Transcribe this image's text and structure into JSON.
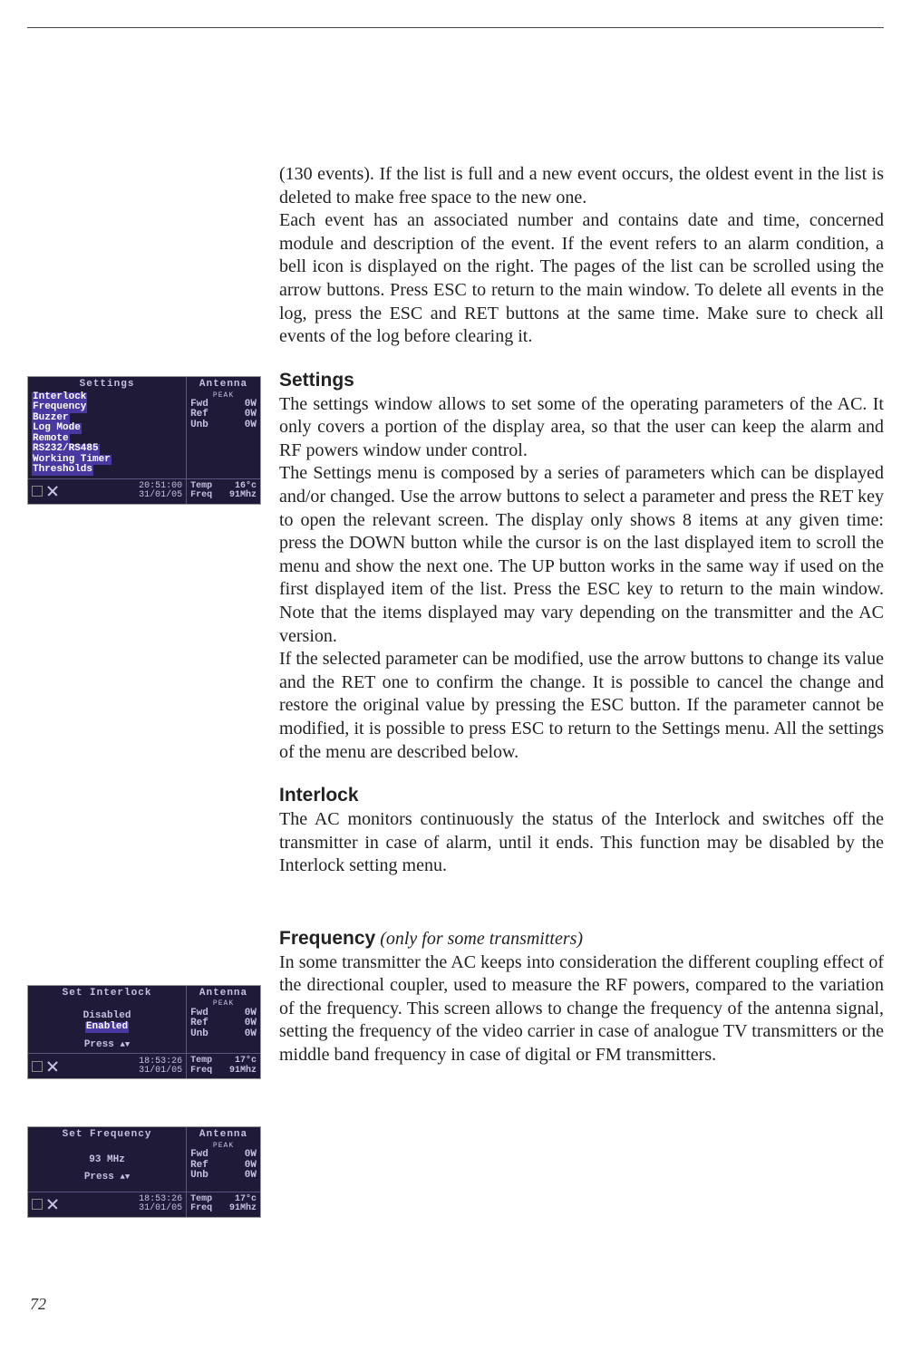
{
  "intro": {
    "p1": "(130 events). If the list is full and a new event occurs, the oldest event in the list is deleted to make free space to the new one.",
    "p2": "Each event has an associated number and contains date and time, concerned module and description of the event. If the event refers to an alarm condition, a bell icon is displayed on the right. The pages of the list can be scrolled using the arrow buttons. Press ESC to return to the main window. To delete all events in the log, press the ESC and RET buttons at the same time. Make sure to check all events of the log before clearing it."
  },
  "settings": {
    "heading": "Settings",
    "p1": "The settings window allows to set some of the operating parameters of the AC. It only covers a portion of the display area, so that the user can keep the alarm and RF powers window under control.",
    "p2": "The Settings menu is composed by a series of parameters which can be displayed and/or changed. Use the arrow buttons to select a parameter and press the RET key to open the relevant screen. The display only shows 8 items at any given time: press the DOWN button while the cursor is on the last displayed item to scroll the menu and show the next one. The UP button works in the same way if used on the first displayed item of the list. Press the ESC key to return to the main window. Note that the items displayed may vary depending on the transmitter and the AC version.",
    "p3": "If the selected parameter can be modified, use the arrow buttons to change its value and the RET one to confirm the change. It is possible to cancel the change and restore the original value by pressing the ESC button. If the parameter cannot be modified, it is possible to press ESC to return to the Settings menu. All the settings of the menu are described below."
  },
  "interlock": {
    "heading": "Interlock",
    "body": "The AC monitors continuously the status of the Interlock and switches off the transmitter in case of alarm, until it ends. This function may be disabled by the Interlock setting menu."
  },
  "frequency": {
    "heading": "Frequency",
    "note": "(only for some transmitters)",
    "body": "In some transmitter the AC keeps into consideration the different coupling effect of the directional coupler, used to measure the RF powers, compared to the variation of the frequency. This screen allows to change the frequency of the antenna signal, setting the frequency of the video carrier in case of analogue TV transmitters or the middle band frequency in case of digital or FM transmitters."
  },
  "lcd1": {
    "title": "Settings",
    "menu": [
      "Interlock",
      "Frequency",
      "Buzzer",
      "Log Mode",
      "Remote",
      "RS232/RS485",
      "Working Timer",
      "Thresholds"
    ],
    "antenna_label": "Antenna",
    "peak": "PEAK",
    "fwd": "Fwd",
    "fwd_v": "0W",
    "ref": "Ref",
    "ref_v": "0W",
    "unb": "Unb",
    "unb_v": "0W",
    "temp": "Temp",
    "temp_v": "16°c",
    "freq": "Freq",
    "freq_v": "91Mhz",
    "time": "20:51:00",
    "date": "31/01/05"
  },
  "lcd2": {
    "title": "Set  Interlock",
    "disabled": "Disabled",
    "enabled": "Enabled",
    "press": "Press",
    "antenna_label": "Antenna",
    "peak": "PEAK",
    "fwd": "Fwd",
    "fwd_v": "0W",
    "ref": "Ref",
    "ref_v": "0W",
    "unb": "Unb",
    "unb_v": "0W",
    "temp": "Temp",
    "temp_v": "17°c",
    "freq": "Freq",
    "freq_v": "91Mhz",
    "time": "18:53:26",
    "date": "31/01/05"
  },
  "lcd3": {
    "title": "Set Frequency",
    "value": "93 MHz",
    "press": "Press",
    "antenna_label": "Antenna",
    "peak": "PEAK",
    "fwd": "Fwd",
    "fwd_v": "0W",
    "ref": "Ref",
    "ref_v": "0W",
    "unb": "Unb",
    "unb_v": "0W",
    "temp": "Temp",
    "temp_v": "17°c",
    "freq": "Freq",
    "freq_v": "91Mhz",
    "time": "18:53:26",
    "date": "31/01/05"
  },
  "page_number": "72"
}
